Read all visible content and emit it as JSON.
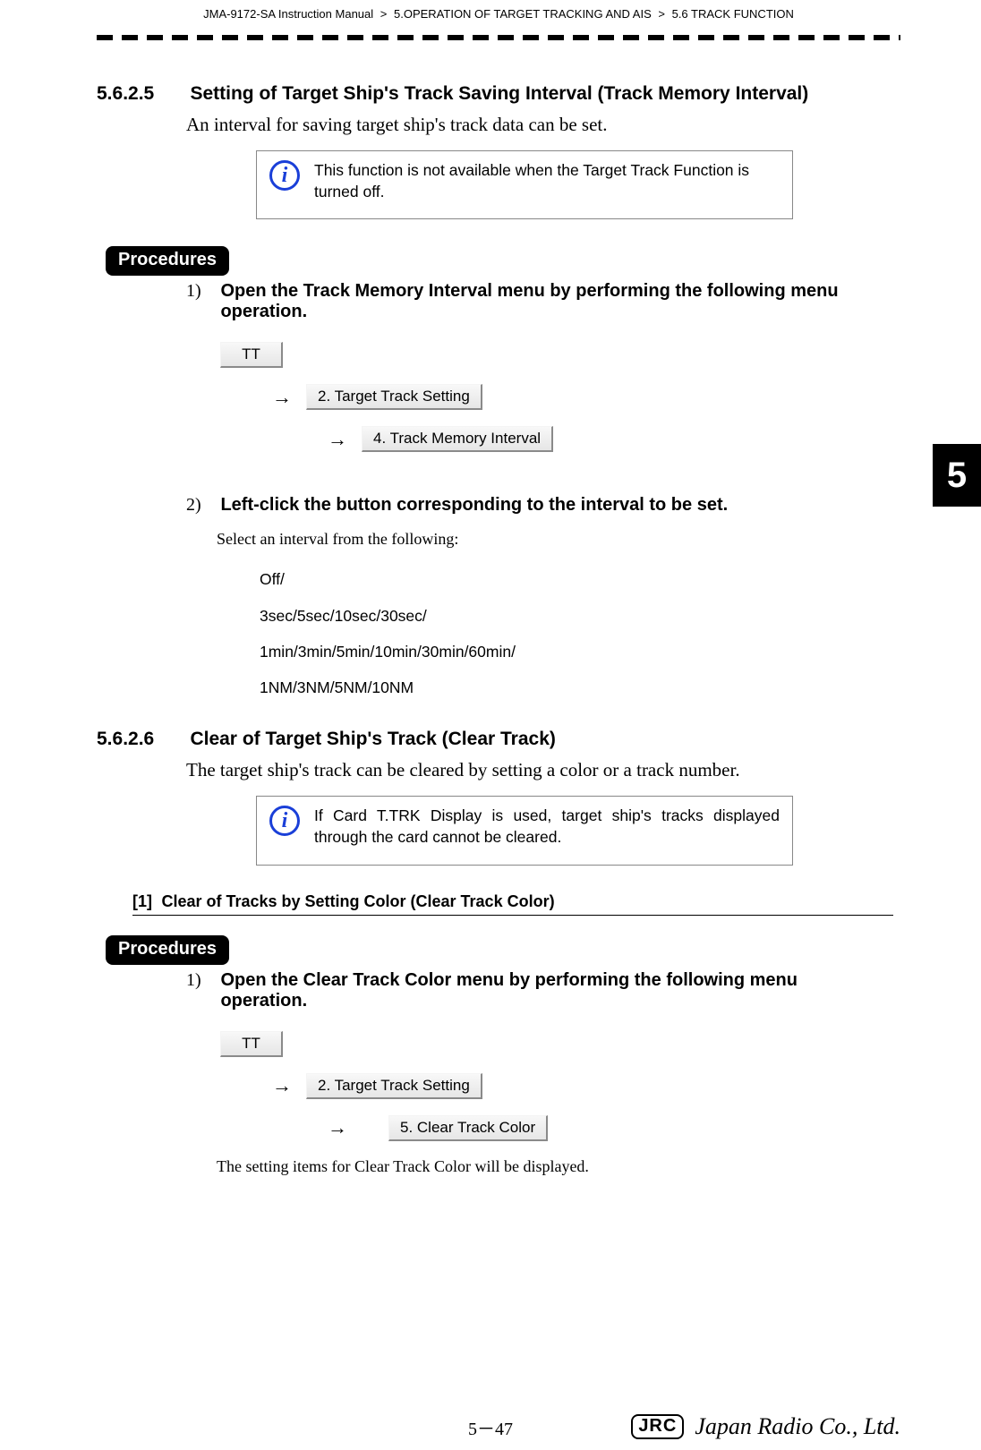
{
  "header": {
    "doc": "JMA-9172-SA Instruction Manual",
    "chapter": "5.OPERATION OF TARGET TRACKING AND AIS",
    "section": "5.6  TRACK FUNCTION",
    "gt": ">"
  },
  "side_tab": "5",
  "s1": {
    "num": "5.6.2.5",
    "title": "Setting of Target Ship's Track Saving Interval (Track Memory Interval)",
    "intro": "An interval for saving target ship's track data can be set.",
    "info": "This function is not available when the Target Track Function is turned off.",
    "procedures_label": "Procedures",
    "step1_num": "1)",
    "step1_title": "Open the Track Memory Interval menu by performing the following menu operation.",
    "menu": {
      "btn1": "TT",
      "btn2": "2. Target Track Setting",
      "btn3": "4. Track Memory Interval",
      "arrow": "→"
    },
    "step2_num": "2)",
    "step2_title": "Left-click the button corresponding to the interval to be set.",
    "step2_body": "Select an interval from the following:",
    "options": {
      "l1": "Off/",
      "l2": "3sec/5sec/10sec/30sec/",
      "l3": "1min/3min/5min/10min/30min/60min/",
      "l4": "1NM/3NM/5NM/10NM"
    }
  },
  "s2": {
    "num": "5.6.2.6",
    "title": "Clear of Target Ship's Track (Clear Track)",
    "intro": "The target ship's track can be cleared by setting a color or a track number.",
    "info": "If Card T.TRK Display is used, target ship's tracks displayed through the card cannot be cleared.",
    "sub_tag": "[1]",
    "sub_title": "Clear of Tracks by Setting Color (Clear Track Color)",
    "procedures_label": "Procedures",
    "step1_num": "1)",
    "step1_title": "Open the Clear Track Color menu by performing the following menu operation.",
    "menu": {
      "btn1": "TT",
      "btn2": "2. Target Track Setting",
      "btn3": "5. Clear Track Color",
      "arrow": "→"
    },
    "follow": "The setting items for Clear Track Color will be displayed."
  },
  "footer": {
    "page": "5－47",
    "jrc": "JRC",
    "company": "Japan Radio Co., Ltd."
  },
  "info_glyph": "i"
}
